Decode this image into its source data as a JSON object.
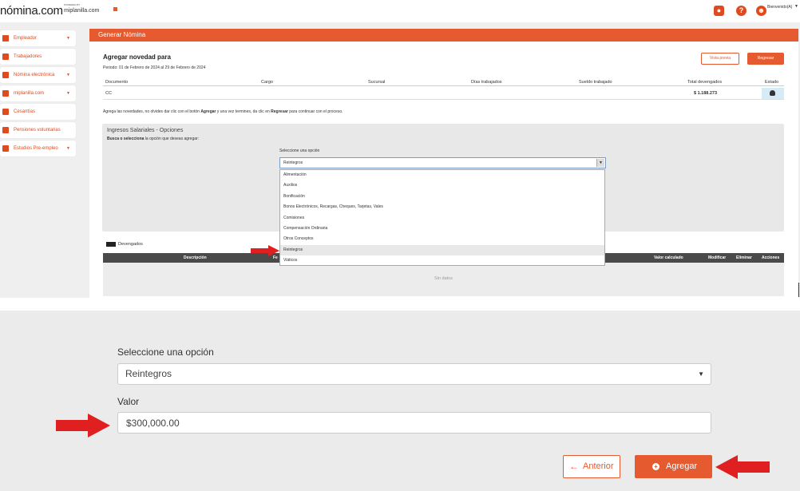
{
  "header": {
    "logo": "nómina.com",
    "powered_by": "POWERED BY",
    "powered_name": "miplanilla.com",
    "welcome": "Bienvenido(A)"
  },
  "sidebar": {
    "items": [
      {
        "label": "Empleador",
        "icon": "building-icon",
        "has_caret": true
      },
      {
        "label": "Trabajadores",
        "icon": "users-icon",
        "has_caret": false
      },
      {
        "label": "Nómina electrónica",
        "icon": "document-icon",
        "has_caret": true
      },
      {
        "label": "miplanilla.com",
        "icon": "document-icon",
        "has_caret": true
      },
      {
        "label": "Cesantías",
        "icon": "piggy-bank-icon",
        "has_caret": false
      },
      {
        "label": "Pensiones voluntarias",
        "icon": "hourglass-icon",
        "has_caret": false
      },
      {
        "label": "Estudios Pre-empleo",
        "icon": "user-check-icon",
        "has_caret": true
      }
    ]
  },
  "main": {
    "header_title": "Generar Nómina",
    "title": "Agregar novedad para",
    "period": "Periodo: 01 de Febrero de 2024 al 29 de Febrero de 2024",
    "preview_button": "Vista previa",
    "back_button": "Regresar",
    "table": {
      "headers": [
        "Documento",
        "Cargo",
        "Sucursal",
        "Días trabajados",
        "Sueldo trabajado",
        "Total devengados",
        "Estado"
      ],
      "row": {
        "documento": "CC ",
        "total": "$ 1.188.273"
      }
    },
    "hint_pre": "Agrega las novedades, no olvides dar clic con el botón ",
    "hint_b1": "Agregar",
    "hint_mid": " y una vez termines, da clic en ",
    "hint_b2": "Regresar",
    "hint_post": " para continuar con el proceso.",
    "ingresos": {
      "title": "Ingresos Salariales - Opciones",
      "sub_bold": "Busca o selecciona",
      "sub_rest": " la opción que deseas agregar:",
      "select_label": "Seleccione una opción",
      "select_value": "Reintegros",
      "options": [
        "Alimentación",
        "Auxilios",
        "Bonificación",
        "Bonos Electrónicos, Recargas, Cheques, Tarjetas, Vales",
        "Comisiones",
        "Compensación Ordinaria",
        "Otros Conceptos",
        "Reintegros",
        "Viáticos"
      ],
      "selected_index": 7
    },
    "devengados": {
      "label": "Devengados",
      "headers": {
        "descripcion": "Descripción",
        "fecha": "Fe",
        "valor": "Valor calculado",
        "modificar": "Modificar",
        "eliminar": "Eliminar",
        "acciones": "Acciones"
      },
      "empty": "Sin datos"
    }
  },
  "form": {
    "select_label": "Seleccione una opción",
    "select_value": "Reintegros",
    "valor_label": "Valor",
    "valor_value": "$300,000.00",
    "anterior_button": "Anterior",
    "agregar_button": "Agregar"
  },
  "colors": {
    "accent": "#e55a2f",
    "arrow_red": "#e02020"
  }
}
